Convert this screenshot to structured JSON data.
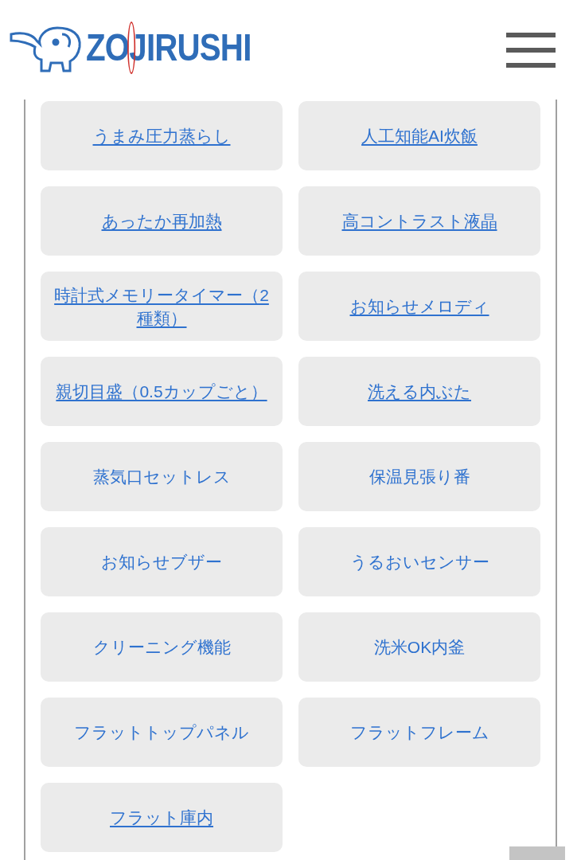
{
  "header": {
    "logo": "ZOJIRUSHI"
  },
  "features": [
    {
      "label": "うまみ圧力蒸らし",
      "kind": "link"
    },
    {
      "label": "人工知能AI炊飯",
      "kind": "link"
    },
    {
      "label": "あったか再加熱",
      "kind": "link"
    },
    {
      "label": "高コントラスト液晶",
      "kind": "link"
    },
    {
      "label": "時計式メモリータイマー（2種類）",
      "kind": "link"
    },
    {
      "label": "お知らせメロディ",
      "kind": "link"
    },
    {
      "label": "親切目盛（0.5カップごと）",
      "kind": "link"
    },
    {
      "label": "洗える内ぶた",
      "kind": "link"
    },
    {
      "label": "蒸気口セットレス",
      "kind": "label"
    },
    {
      "label": "保温見張り番",
      "kind": "label"
    },
    {
      "label": "お知らせブザー",
      "kind": "label"
    },
    {
      "label": "うるおいセンサー",
      "kind": "label"
    },
    {
      "label": "クリーニング機能",
      "kind": "label"
    },
    {
      "label": "洗米OK内釜",
      "kind": "label"
    },
    {
      "label": "フラットトップパネル",
      "kind": "label"
    },
    {
      "label": "フラットフレーム",
      "kind": "label"
    },
    {
      "label": "フラット庫内",
      "kind": "link"
    }
  ]
}
